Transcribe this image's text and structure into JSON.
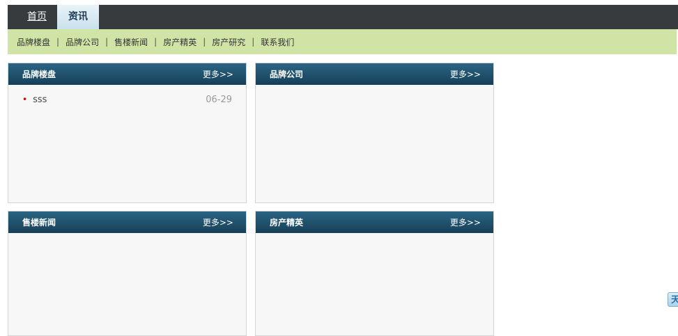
{
  "nav": {
    "tabs": [
      {
        "label": "首页"
      },
      {
        "label": "资讯"
      }
    ]
  },
  "subnav": {
    "items": [
      "品牌楼盘",
      "品牌公司",
      "售楼新闻",
      "房产精英",
      "房产研究",
      "联系我们"
    ],
    "separator": "|"
  },
  "panels": [
    {
      "title": "品牌楼盘",
      "more": "更多>>",
      "items": [
        {
          "title": "sss",
          "date": "06-29"
        }
      ]
    },
    {
      "title": "品牌公司",
      "more": "更多>>",
      "items": []
    },
    {
      "title": "售楼新闻",
      "more": "更多>>",
      "items": []
    },
    {
      "title": "房产精英",
      "more": "更多>>",
      "items": []
    }
  ],
  "float_button": {
    "label": "天"
  }
}
